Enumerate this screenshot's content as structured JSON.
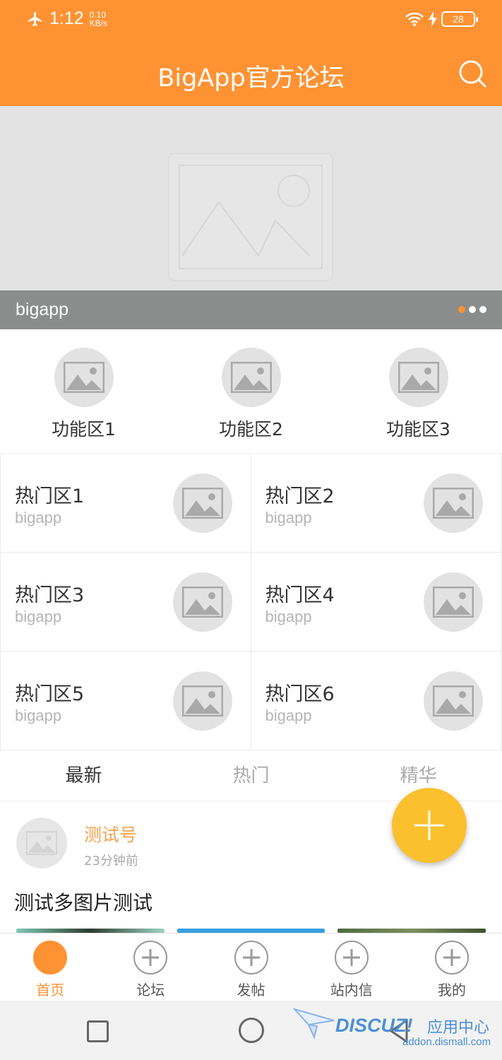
{
  "status_bar": {
    "time": "1:12",
    "speed_value": "0.10",
    "speed_unit": "KB/s",
    "battery": "28",
    "icons": [
      "airplane-icon",
      "wifi-icon",
      "charging-icon",
      "battery-icon"
    ]
  },
  "header": {
    "title": "BigApp官方论坛",
    "search_icon": "search-icon",
    "bg_color": "#ff9233"
  },
  "banner": {
    "caption": "bigapp",
    "page_count": 3,
    "active_page": 1
  },
  "function_areas": [
    {
      "label": "功能区1"
    },
    {
      "label": "功能区2"
    },
    {
      "label": "功能区3"
    }
  ],
  "hot_areas": [
    {
      "name": "热门区1",
      "sub": "bigapp"
    },
    {
      "name": "热门区2",
      "sub": "bigapp"
    },
    {
      "name": "热门区3",
      "sub": "bigapp"
    },
    {
      "name": "热门区4",
      "sub": "bigapp"
    },
    {
      "name": "热门区5",
      "sub": "bigapp"
    },
    {
      "name": "热门区6",
      "sub": "bigapp"
    }
  ],
  "tabs": [
    {
      "label": "最新",
      "active": true
    },
    {
      "label": "热门",
      "active": false
    },
    {
      "label": "精华",
      "active": false
    }
  ],
  "post": {
    "author": "测试号",
    "time": "23分钟前",
    "title": "测试多图片测试"
  },
  "fab_icon": "plus-icon",
  "bottom_nav": [
    {
      "label": "首页",
      "active": true
    },
    {
      "label": "论坛",
      "active": false
    },
    {
      "label": "发帖",
      "active": false
    },
    {
      "label": "站内信",
      "active": false
    },
    {
      "label": "我的",
      "active": false
    }
  ],
  "watermark": {
    "brand": "DISCUZ!",
    "cn": "应用中心",
    "url": "addon.dismall.com"
  },
  "colors": {
    "accent": "#ff9233",
    "fab": "#fbc02d",
    "author": "#f7a04a"
  }
}
